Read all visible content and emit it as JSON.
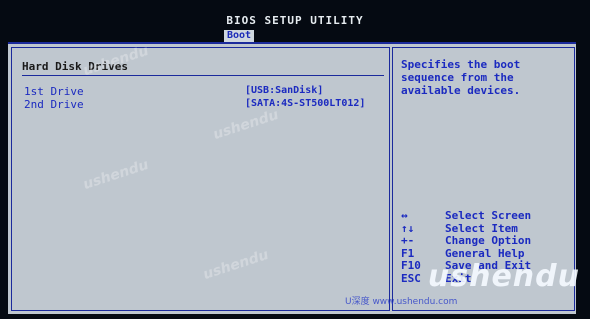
{
  "bios": {
    "title": "BIOS SETUP UTILITY",
    "active_tab": "Boot"
  },
  "section": {
    "title": "Hard Disk Drives",
    "items": [
      {
        "label": "1st Drive",
        "value": "[USB:SanDisk]"
      },
      {
        "label": "2nd Drive",
        "value": "[SATA:4S-ST500LT012]"
      }
    ]
  },
  "help": {
    "text": "Specifies the boot\nsequence from the\navailable devices."
  },
  "keys": [
    {
      "key": "↔",
      "desc": "Select Screen"
    },
    {
      "key": "↑↓",
      "desc": "Select Item"
    },
    {
      "key": "+-",
      "desc": "Change Option"
    },
    {
      "key": "F1",
      "desc": "General Help"
    },
    {
      "key": "F10",
      "desc": "Save and Exit"
    },
    {
      "key": "ESC",
      "desc": "Exit"
    }
  ],
  "watermark": {
    "logo": "ushendu",
    "url": "U深度 www.ushendu.com"
  }
}
